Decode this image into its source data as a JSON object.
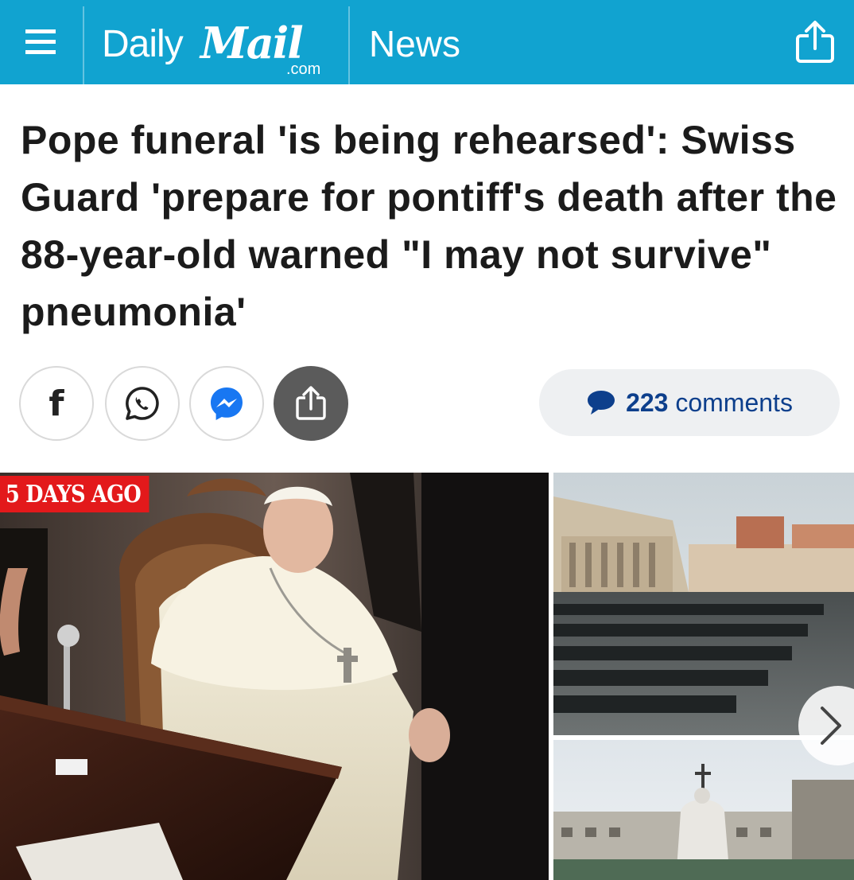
{
  "header": {
    "brand_daily": "Daily",
    "brand_mail": "Mail",
    "brand_com": ".com",
    "section": "News",
    "menu_icon": "hamburger-menu-icon",
    "share_icon": "share-icon"
  },
  "article": {
    "headline": "Pope funeral 'is being rehearsed': Swiss Guard 'prepare for pontiff's death after the 88-year-old warned \"I may not survive\" pneumonia'"
  },
  "share": {
    "facebook_label": "f",
    "icons": [
      "facebook-icon",
      "whatsapp-icon",
      "messenger-icon",
      "share-icon"
    ],
    "comments_count": "223",
    "comments_label": "comments"
  },
  "gallery": {
    "badge": "5 DAYS AGO",
    "next_icon": "chevron-right-icon"
  },
  "colors": {
    "brand_blue": "#11a3d0",
    "comments_blue": "#0d3f8c",
    "badge_red": "#e3191b",
    "share_gray": "#5b5b5b"
  }
}
